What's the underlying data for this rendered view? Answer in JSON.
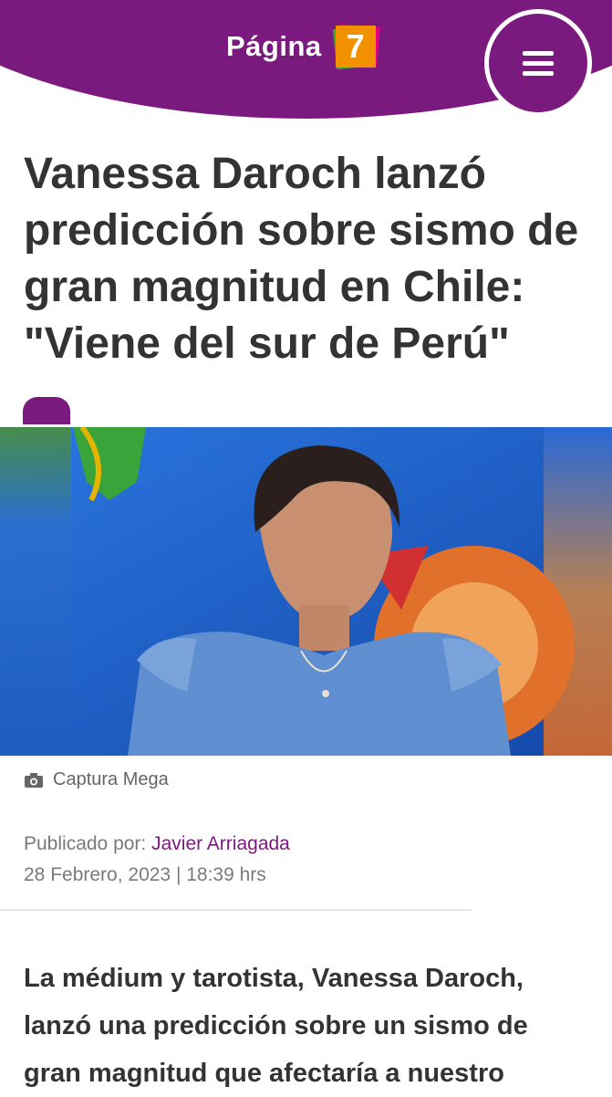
{
  "header": {
    "logo_text": "Página",
    "logo_number": "7",
    "brand_color": "#7a1a7f",
    "menu_icon": "hamburger-icon"
  },
  "article": {
    "title": "Vanessa Daroch lanzó predicción sobre sismo de gran magnitud en Chile: \"Viene del sur de Perú\"",
    "image_caption": "Captura Mega",
    "caption_icon": "camera-icon",
    "published_label": "Publicado por:",
    "author": "Javier Arriagada",
    "date": "28 Febrero, 2023 | 18:39 hrs",
    "lead": "La médium y tarotista, Vanessa Daroch, lanzó una predicción sobre un sismo de gran magnitud que afectaría a nuestro"
  }
}
